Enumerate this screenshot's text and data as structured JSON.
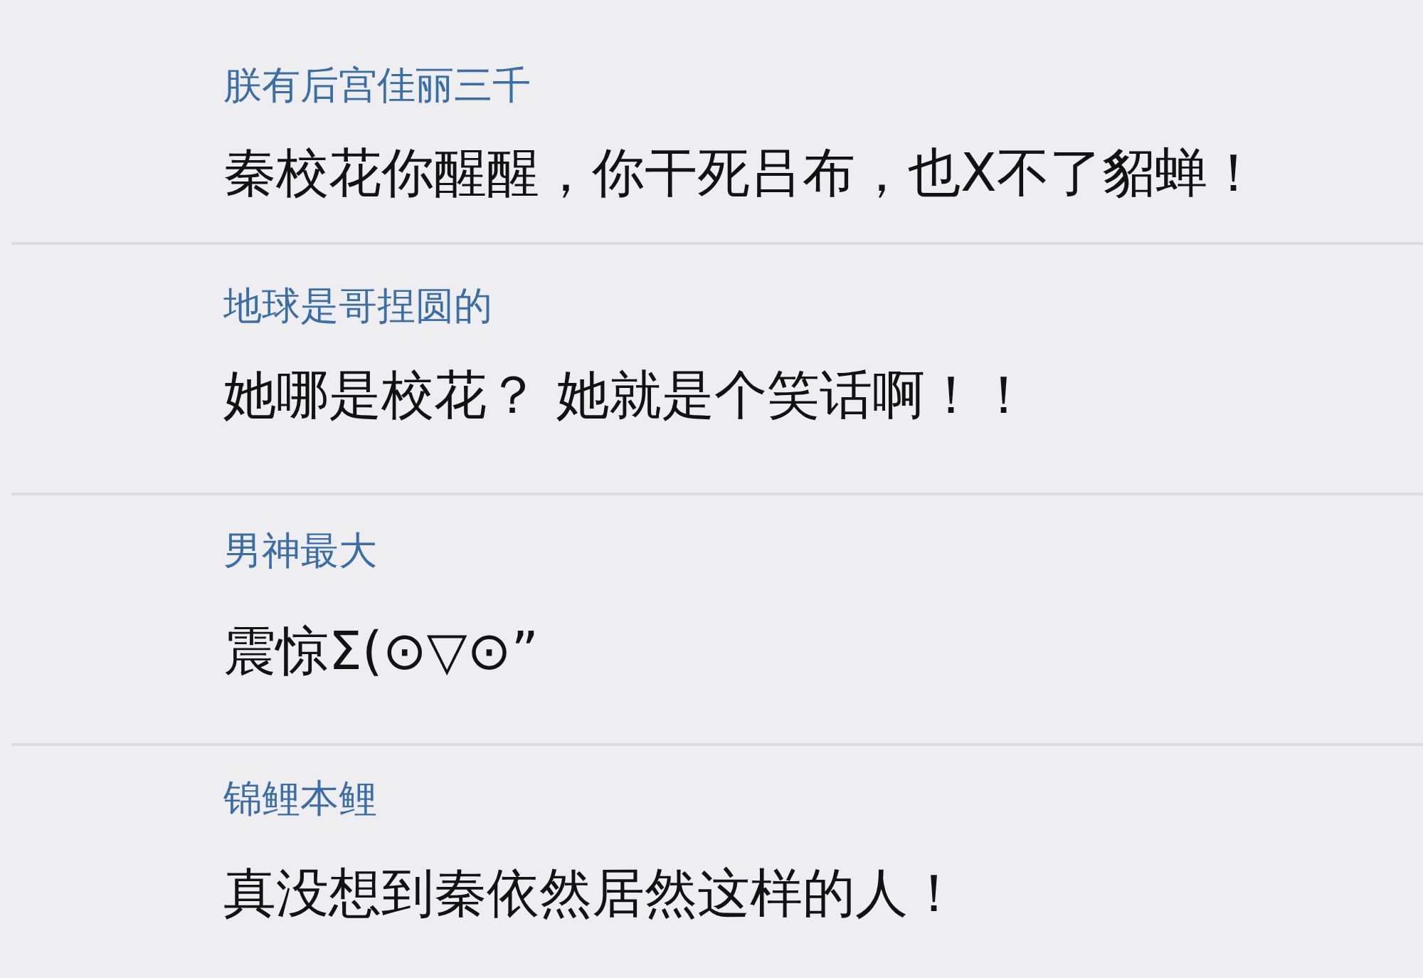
{
  "comments": [
    {
      "username": "朕有后宫佳丽三千",
      "text": "秦校花你醒醒，你干死吕布，也X不了貂蝉！"
    },
    {
      "username": "地球是哥捏圆的",
      "text": "她哪是校花？ 她就是个笑话啊！！"
    },
    {
      "username": "男神最大",
      "text": "震惊Σ(⊙▽⊙”"
    },
    {
      "username": "锦鲤本鲤",
      "text": "真没想到秦依然居然这样的人！"
    }
  ]
}
